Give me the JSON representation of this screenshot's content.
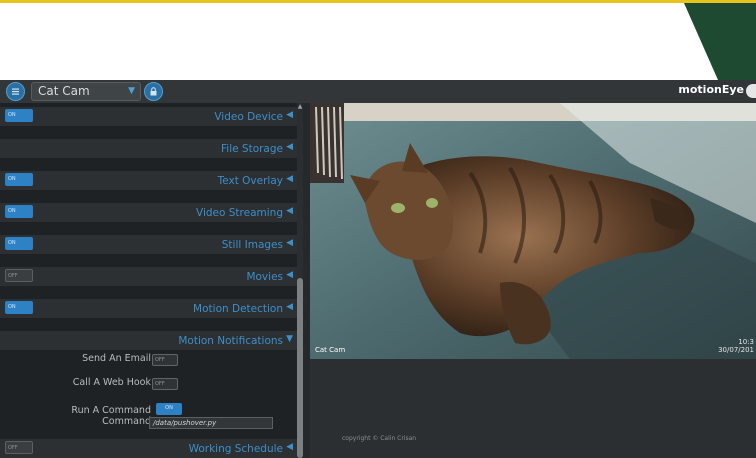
{
  "header": {
    "camera_name": "Cat Cam",
    "brand": "motionEye"
  },
  "sections": [
    {
      "title": "Video Device",
      "toggle": "ON",
      "toggle_state": "on",
      "expanded": false
    },
    {
      "title": "File Storage",
      "toggle": "",
      "toggle_state": "none",
      "expanded": false
    },
    {
      "title": "Text Overlay",
      "toggle": "ON",
      "toggle_state": "on",
      "expanded": false
    },
    {
      "title": "Video Streaming",
      "toggle": "ON",
      "toggle_state": "on",
      "expanded": false
    },
    {
      "title": "Still Images",
      "toggle": "ON",
      "toggle_state": "on",
      "expanded": false
    },
    {
      "title": "Movies",
      "toggle": "OFF",
      "toggle_state": "off",
      "expanded": false
    },
    {
      "title": "Motion Detection",
      "toggle": "ON",
      "toggle_state": "on",
      "expanded": false
    },
    {
      "title": "Motion Notifications",
      "toggle": "",
      "toggle_state": "none",
      "expanded": true
    }
  ],
  "notifications": {
    "send_email_label": "Send An Email",
    "send_email_toggle": "OFF",
    "web_hook_label": "Call A Web Hook",
    "web_hook_toggle": "OFF",
    "run_command_label": "Run A Command",
    "run_command_toggle": "ON",
    "command_label": "Command",
    "command_value": "/data/pushover.py"
  },
  "working_schedule": {
    "title": "Working Schedule",
    "toggle": "OFF"
  },
  "video": {
    "overlay_name": "Cat Cam",
    "overlay_time_line1": "10:3",
    "overlay_time_line2": "30/07/201",
    "copyright": "copyright © Calin Crisan"
  },
  "colors": {
    "accent": "#3d8ec9",
    "toggle_on": "#2c82c4",
    "panel_bg": "#1f2224",
    "header_bg": "#323638",
    "top_line": "#e7c41c",
    "corner": "#1d4a30"
  }
}
